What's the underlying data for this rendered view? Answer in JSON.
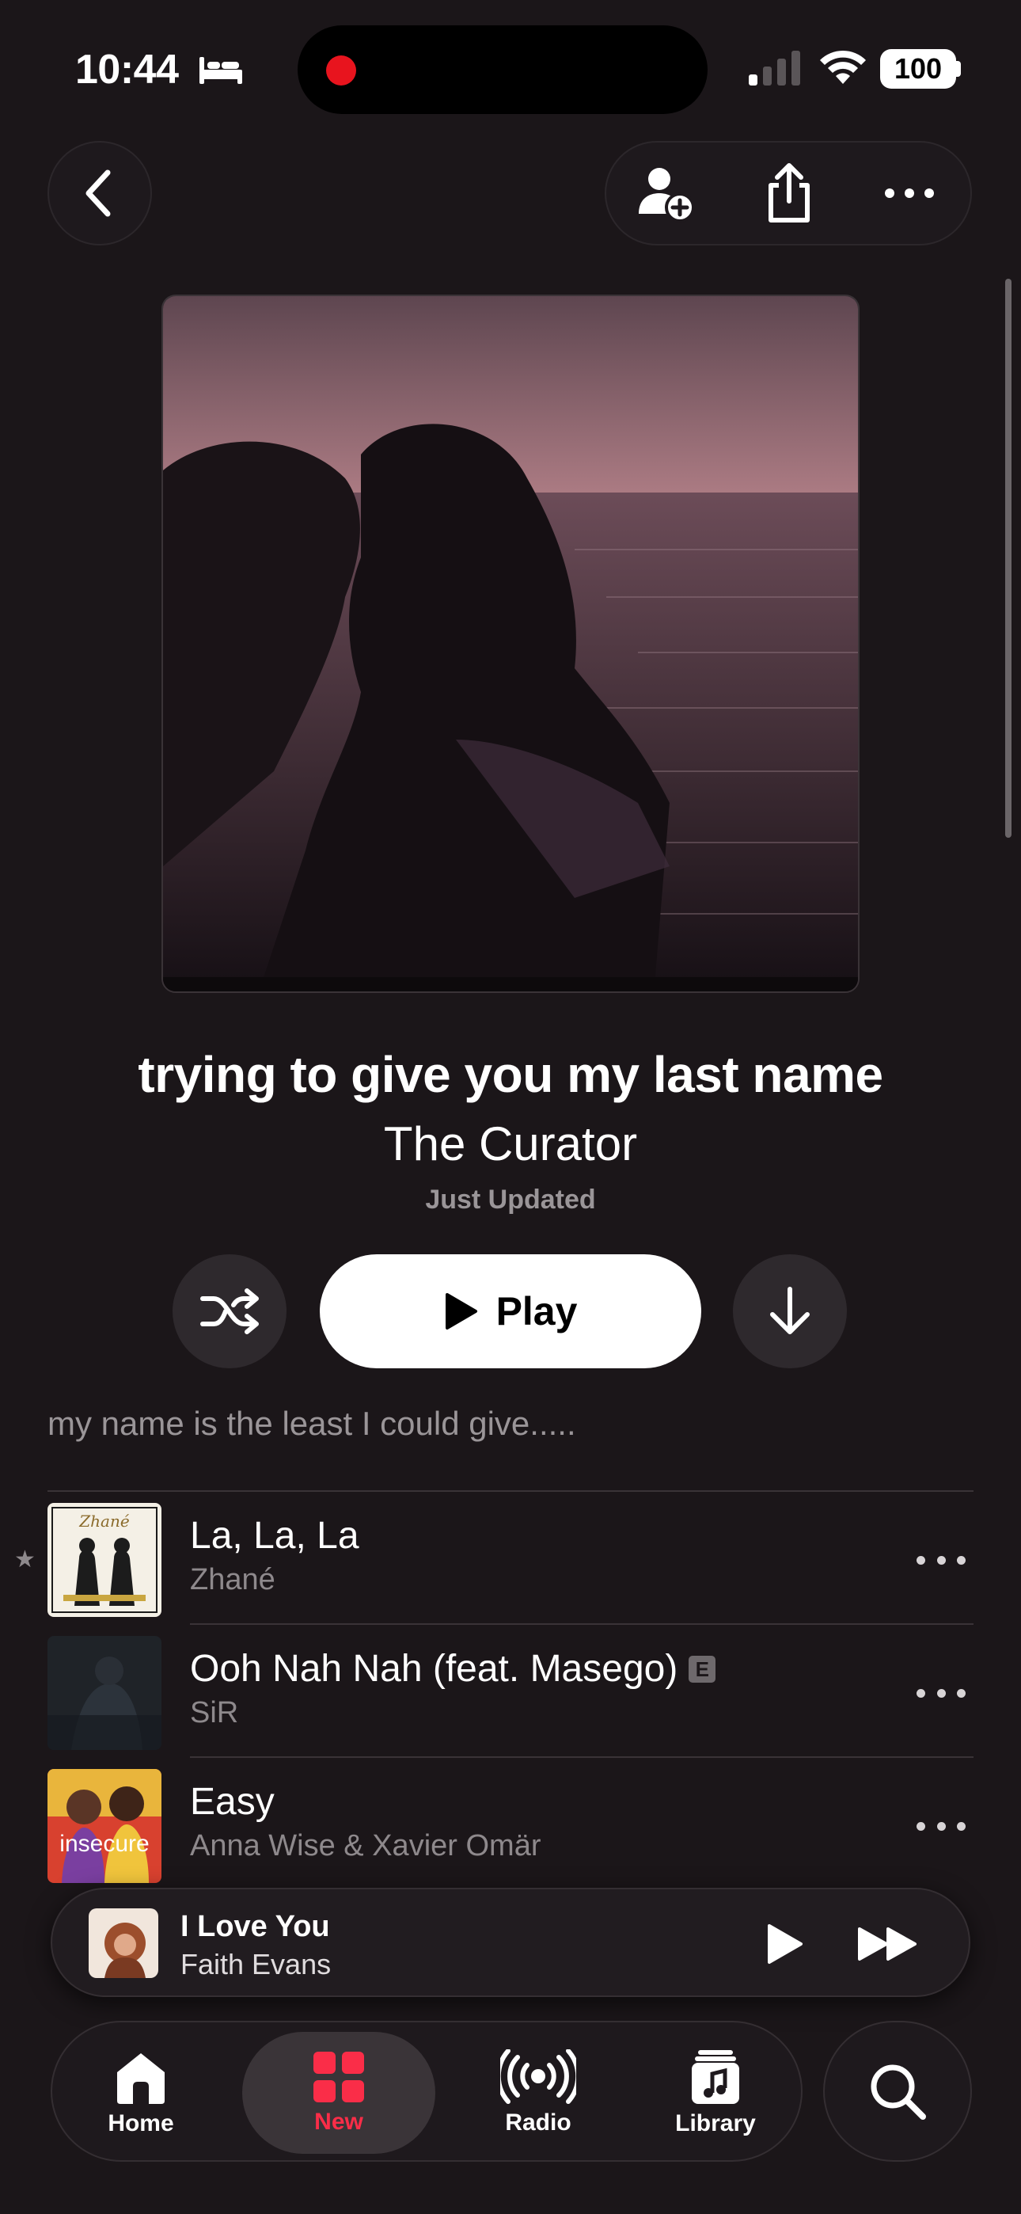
{
  "status_bar": {
    "time": "10:44",
    "battery": "100",
    "icons": [
      "bed-icon",
      "signal-icon",
      "wifi-icon",
      "battery-icon"
    ],
    "recording_color": "#e8141e"
  },
  "top_nav": {
    "icons": [
      "chevron-left-icon",
      "add-person-icon",
      "share-icon",
      "more-icon"
    ]
  },
  "playlist": {
    "title": "trying to give you my last name",
    "curator": "The Curator",
    "status": "Just Updated",
    "description": "my name is the least I could give....."
  },
  "controls": {
    "play_label": "Play",
    "icons": [
      "shuffle-icon",
      "play-icon",
      "download-icon"
    ]
  },
  "tracks": [
    {
      "title": "La, La, La",
      "artist": "Zhané",
      "explicit": false,
      "favorite": true
    },
    {
      "title": "Ooh Nah Nah (feat. Masego)",
      "artist": "SiR",
      "explicit": true,
      "explicit_label": "E"
    },
    {
      "title": "Easy",
      "artist": "Anna Wise & Xavier Omär",
      "explicit": false,
      "art_text": "insecure"
    }
  ],
  "now_playing": {
    "title": "I Love You",
    "artist": "Faith Evans"
  },
  "tabs": [
    {
      "label": "Home",
      "icon": "home-icon"
    },
    {
      "label": "New",
      "icon": "grid-icon",
      "active": true
    },
    {
      "label": "Radio",
      "icon": "radio-icon"
    },
    {
      "label": "Library",
      "icon": "library-icon"
    }
  ],
  "colors": {
    "background": "#1b1619",
    "accent": "#fa2d48"
  }
}
